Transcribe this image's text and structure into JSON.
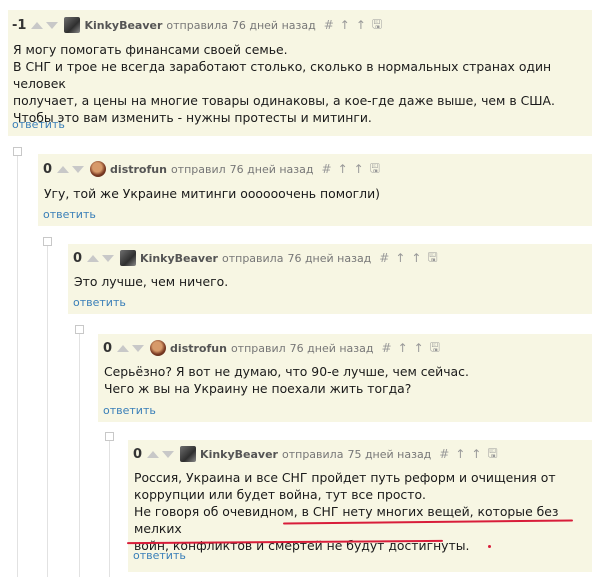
{
  "reply_label": "ответить",
  "tools": {
    "anchor": "#",
    "parent": "↑",
    "thread": "↑",
    "save": "🖫"
  },
  "comments": [
    {
      "rating": "-1",
      "username": "KinkyBeaver",
      "action": "отправила",
      "time": "76 дней назад",
      "avatar_icon": "beaver-avatar",
      "lines": [
        "Я могу помогать финансами своей семье.",
        "В СНГ и трое не всегда заработают столько, сколько в нормальных странах один человек",
        "получает, а цены на многие товары одинаковы, а кое-где даже выше, чем в США.",
        "Чтобы это вам изменить - нужны протесты и митинги."
      ]
    },
    {
      "rating": "0",
      "username": "distrofun",
      "action": "отправил",
      "time": "76 дней назад",
      "avatar_icon": "distrofun-avatar",
      "lines": [
        "Угу, той же Украине митинги оооооочень помогли)"
      ]
    },
    {
      "rating": "0",
      "username": "KinkyBeaver",
      "action": "отправила",
      "time": "76 дней назад",
      "avatar_icon": "beaver-avatar",
      "lines": [
        "Это лучше, чем ничего."
      ]
    },
    {
      "rating": "0",
      "username": "distrofun",
      "action": "отправил",
      "time": "76 дней назад",
      "avatar_icon": "distrofun-avatar",
      "lines": [
        "Серьёзно? Я вот не думаю, что 90-е лучше, чем сейчас.",
        "Чего ж вы на Украину не поехали жить тогда?"
      ]
    },
    {
      "rating": "0",
      "username": "KinkyBeaver",
      "action": "отправила",
      "time": "75 дней назад",
      "avatar_icon": "beaver-avatar",
      "lines": [
        "Россия, Украина и все СНГ пройдет путь реформ и очищения от",
        "коррупции или будет война, тут все просто.",
        "Не говоря об очевидном, в СНГ нету многих вещей, которые без мелких",
        "войн, конфликтов и смертей не будут достигнуты."
      ]
    }
  ],
  "colors": {
    "comment_bg": "#f7f6e3",
    "link": "#3a7fb8",
    "annotation": "#d81d3a"
  }
}
